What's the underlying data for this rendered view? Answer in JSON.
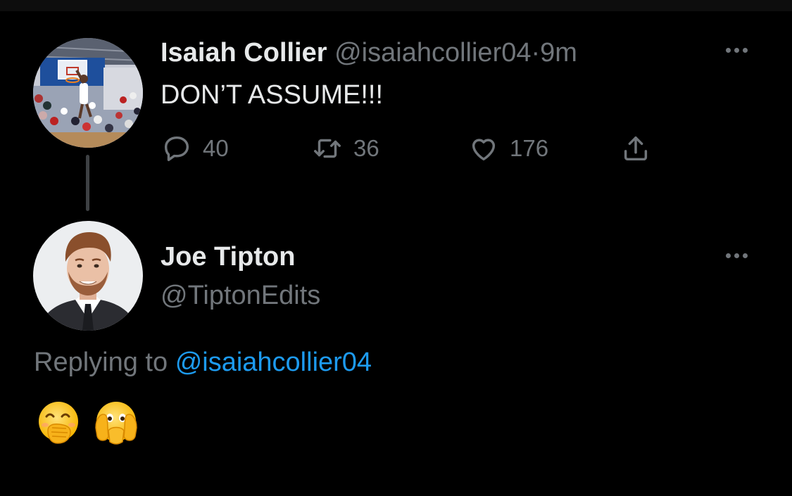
{
  "parent_tweet": {
    "author_name": "Isaiah Collier",
    "handle": "@isaiahcollier04",
    "separator": "·",
    "time": "9m",
    "text": "DON’T ASSUME!!!",
    "avatar_icon": "basketball-game-photo",
    "actions": {
      "reply_icon": "reply-bubble-icon",
      "reply_count": "40",
      "retweet_icon": "retweet-icon",
      "retweet_count": "36",
      "like_icon": "heart-icon",
      "like_count": "176",
      "share_icon": "share-icon"
    }
  },
  "reply_tweet": {
    "author_name": "Joe Tipton",
    "handle": "@TiptonEdits",
    "replying_prefix": "Replying to",
    "replying_to": "@isaiahcollier04",
    "avatar_icon": "headshot-photo",
    "emojis": [
      "face-with-hand-over-mouth-emoji",
      "face-with-open-eyes-and-hand-over-mouth-emoji"
    ]
  },
  "colors": {
    "background": "#000000",
    "primary_text": "#e7e9ea",
    "secondary_text": "#71767b",
    "link": "#1d9bf0",
    "thread_line": "#3e4144"
  }
}
